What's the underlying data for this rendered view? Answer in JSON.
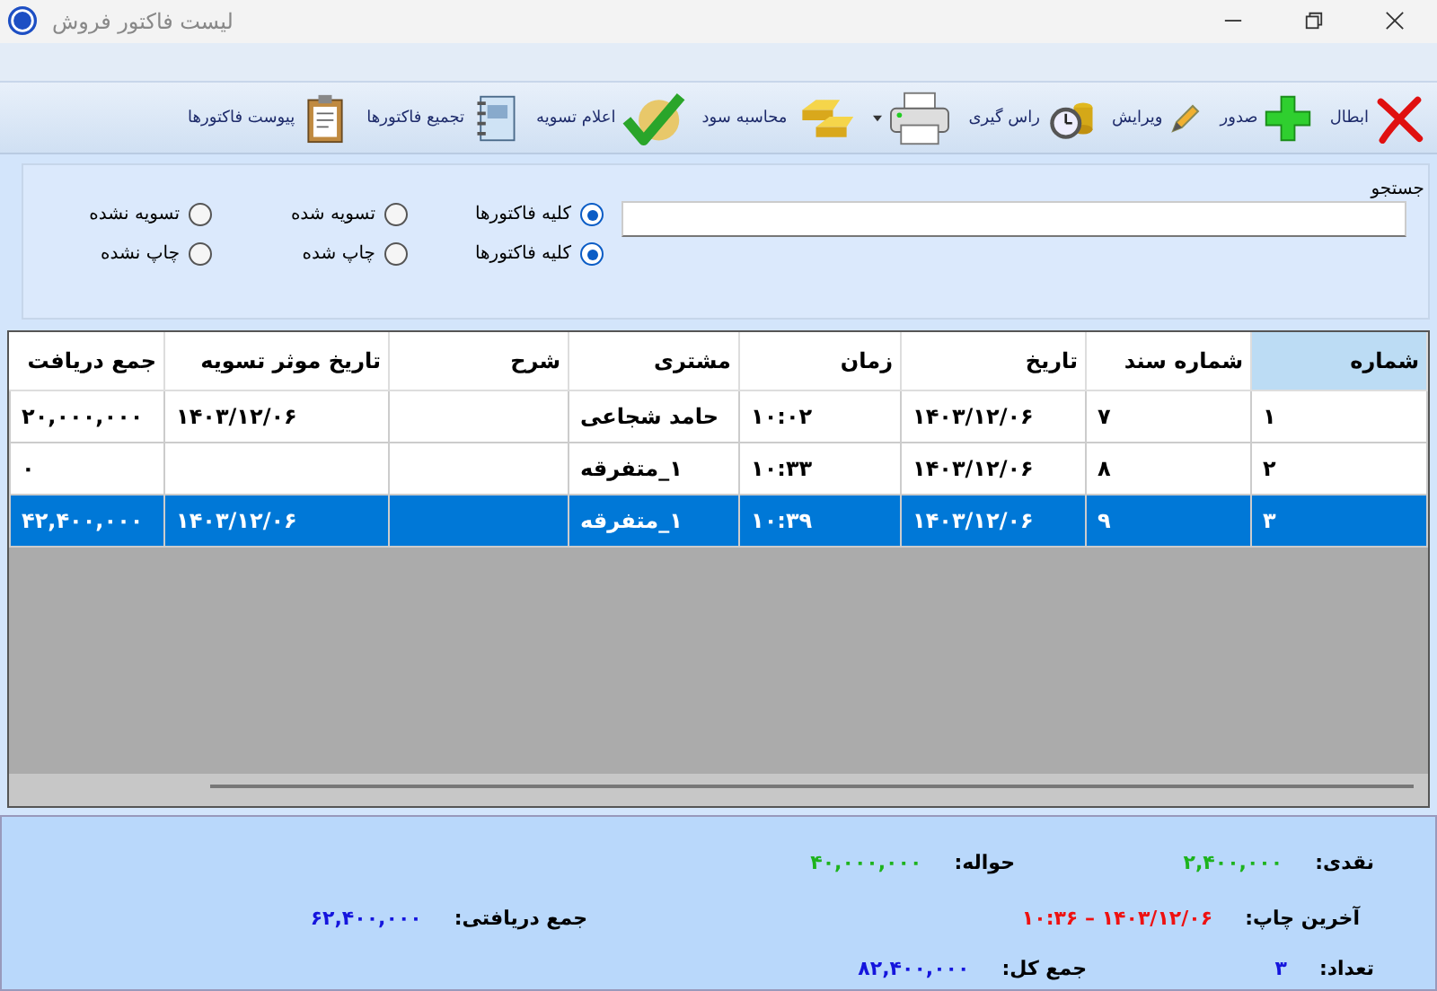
{
  "window": {
    "title": "لیست فاکتور فروش"
  },
  "toolbar": [
    {
      "kind": "cancel",
      "label": "ابطال"
    },
    {
      "kind": "add",
      "label": "صدور"
    },
    {
      "kind": "edit",
      "label": "ویرایش"
    },
    {
      "kind": "clock",
      "label": "راس گیری"
    },
    {
      "kind": "print",
      "dropdown": true
    },
    {
      "kind": "gold",
      "label": "محاسبه سود"
    },
    {
      "kind": "check",
      "label": "اعلام تسویه"
    },
    {
      "kind": "notebook",
      "label": "تجمیع فاکتورها"
    },
    {
      "kind": "clipboard",
      "label": "پیوست فاکتورها"
    }
  ],
  "search": {
    "label": "جستجو"
  },
  "filters": [
    [
      {
        "label": "کلیه فاکتورها",
        "selected": true
      },
      {
        "label": "تسویه شده",
        "selected": false
      },
      {
        "label": "تسویه نشده",
        "selected": false
      }
    ],
    [
      {
        "label": "کلیه فاکتورها",
        "selected": true
      },
      {
        "label": "چاپ شده",
        "selected": false
      },
      {
        "label": "چاپ نشده",
        "selected": false
      }
    ]
  ],
  "table": {
    "columns": [
      {
        "label": "شماره",
        "sorted": true
      },
      {
        "label": "شماره سند",
        "sorted": false
      },
      {
        "label": "تاریخ",
        "sorted": false
      },
      {
        "label": "زمان",
        "sorted": false
      },
      {
        "label": "مشتری",
        "sorted": false
      },
      {
        "label": "شرح",
        "sorted": false
      },
      {
        "label": "تاریخ موثر تسویه",
        "sorted": false
      },
      {
        "label": "جمع دریافت",
        "sorted": false
      }
    ],
    "rows": [
      {
        "selected": false,
        "cells": [
          "۱",
          "۷",
          "۱۴۰۳/۱۲/۰۶",
          "۱۰:۰۲",
          "حامد شجاعی",
          "",
          "۱۴۰۳/۱۲/۰۶",
          "۲۰,۰۰۰,۰۰۰"
        ]
      },
      {
        "selected": false,
        "cells": [
          "۲",
          "۸",
          "۱۴۰۳/۱۲/۰۶",
          "۱۰:۳۳",
          "۱_متفرقه",
          "",
          "",
          "۰"
        ]
      },
      {
        "selected": true,
        "cells": [
          "۳",
          "۹",
          "۱۴۰۳/۱۲/۰۶",
          "۱۰:۳۹",
          "۱_متفرقه",
          "",
          "۱۴۰۳/۱۲/۰۶",
          "۴۲,۴۰۰,۰۰۰"
        ]
      }
    ]
  },
  "footer": [
    [
      {
        "label": "نقدی:",
        "value": "۲,۴۰۰,۰۰۰",
        "color": "#1db31d"
      },
      {
        "label": "حواله:",
        "value": "۴۰,۰۰۰,۰۰۰",
        "color": "#1db31d"
      }
    ],
    [
      {
        "label": "آخرین چاپ:",
        "value": "۱۴۰۳/۱۲/۰۶ – ۱۰:۳۶",
        "color": "#ee1111"
      },
      {
        "label": "جمع دریافتی:",
        "value": "۶۲,۴۰۰,۰۰۰",
        "color": "#1515dd"
      }
    ],
    [
      {
        "label": "تعداد:",
        "value": "۳",
        "color": "#1515dd"
      },
      {
        "label": "جمع کل:",
        "value": "۸۲,۴۰۰,۰۰۰",
        "color": "#1515dd"
      }
    ]
  ]
}
